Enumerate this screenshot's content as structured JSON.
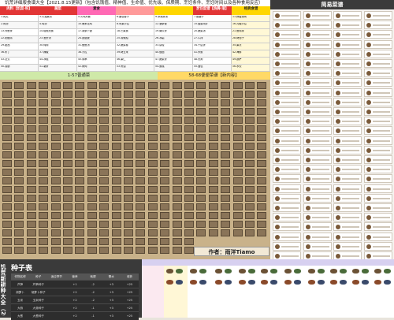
{
  "header": {
    "title": "饥荒详细版食谱大全【2021.8.15更新】（包含饥饿值、精神值、生命值、优先级、保质期、烹饪条件、烹饪时间以及各种食用反应）"
  },
  "categories": [
    {
      "label": "肉料【饥菜·积】",
      "color": "#e23636",
      "text": "#fff"
    },
    {
      "label": "蔬菜",
      "color": "#e23636",
      "text": "#fff"
    },
    {
      "label": "素食",
      "color": "#ff69b4",
      "text": "#222"
    },
    {
      "label": "",
      "color": "#ff9a9a",
      "text": "#222"
    },
    {
      "label": "",
      "color": "#ffd600",
      "text": "#222"
    },
    {
      "label": "烹饪菜谱【热腾·溶】",
      "color": "#e23636",
      "text": "#fff"
    },
    {
      "label": "经典食谱",
      "color": "#ffd600",
      "text": "#222"
    }
  ],
  "cells": [
    "1.肉丸",
    "3.火龙果派",
    "5.火鸡大餐",
    "6.面包卷子",
    "9.冰淇淋汤",
    "7.鱼腊子",
    "11.蜂蜜烧肉",
    "2.肉汤",
    "4.鸡汤",
    "10.爆米花鸡",
    "8.水果沙拉",
    "12.菠萝饭",
    "15.酸菜肉片",
    "16.青椒沙拉",
    "13.炸鱼条",
    "14.培根煎蛋",
    "17.胡萝卜饭",
    "18.芒果蛋",
    "19.南瓜饼",
    "20.蔬菜汤",
    "21.鱼肉排",
    "22.奶酪派",
    "23.龙虾汤",
    "24.蘑菇饭",
    "25.香蕉船",
    "26.冰霜",
    "27.牛排",
    "28.烤茄子",
    "29.甜品",
    "30.炖肉",
    "31.鱿鱼汤",
    "32.蔬菜卷",
    "33.杂烩",
    "34.千层饼",
    "35.果冻",
    "36.布丁",
    "37.辣椒",
    "38.沙拉",
    "39.烤玉米",
    "40.饭团",
    "41.炒蛋",
    "42.海鲜",
    "43.法式",
    "44.冰棍",
    "45.肉串",
    "46.果仁",
    "47.蔬菜饼",
    "48.热狗",
    "49.披萨",
    "50.香肠",
    "51.薯条",
    "52.烤肉",
    "53.黄油",
    "54.蛋糕",
    "55.面包",
    "56.水饺"
  ],
  "bands": [
    {
      "label": "1-57普通菜",
      "color": "#cfe9a8"
    },
    {
      "label": "58-68便便菜谱【新内容】",
      "color": "#ffd966"
    }
  ],
  "author": "作者：雨洋Tiamo",
  "simple": {
    "title": "简易菜谱"
  },
  "seeds": {
    "vertical_title": "饥荒新耕种大全（202",
    "title": "种子表",
    "headers": [
      "作物名称",
      "种子",
      "适应季节",
      "营养",
      "耗肥",
      "需水",
      "收获"
    ],
    "rows": [
      [
        "芦笋",
        "芦笋种子",
        "",
        "+1",
        "-2",
        "+3",
        "+25"
      ],
      [
        "胡萝卜",
        "胡萝卜种子",
        "",
        "+2",
        "-2",
        "+3",
        "+25"
      ],
      [
        "玉米",
        "玉米种子",
        "",
        "+2",
        "-2",
        "+3",
        "+25"
      ],
      [
        "大蒜",
        "大蒜种子",
        "",
        "+2",
        "-1",
        "+3",
        "+25"
      ],
      [
        "大葱",
        "大葱种子",
        "",
        "+2",
        "-1",
        "+3",
        "+25"
      ]
    ]
  },
  "colors": {
    "accent": "#3b3b3b",
    "seed_bg": "#3a3a3a",
    "purple": "#d7d0f0"
  }
}
